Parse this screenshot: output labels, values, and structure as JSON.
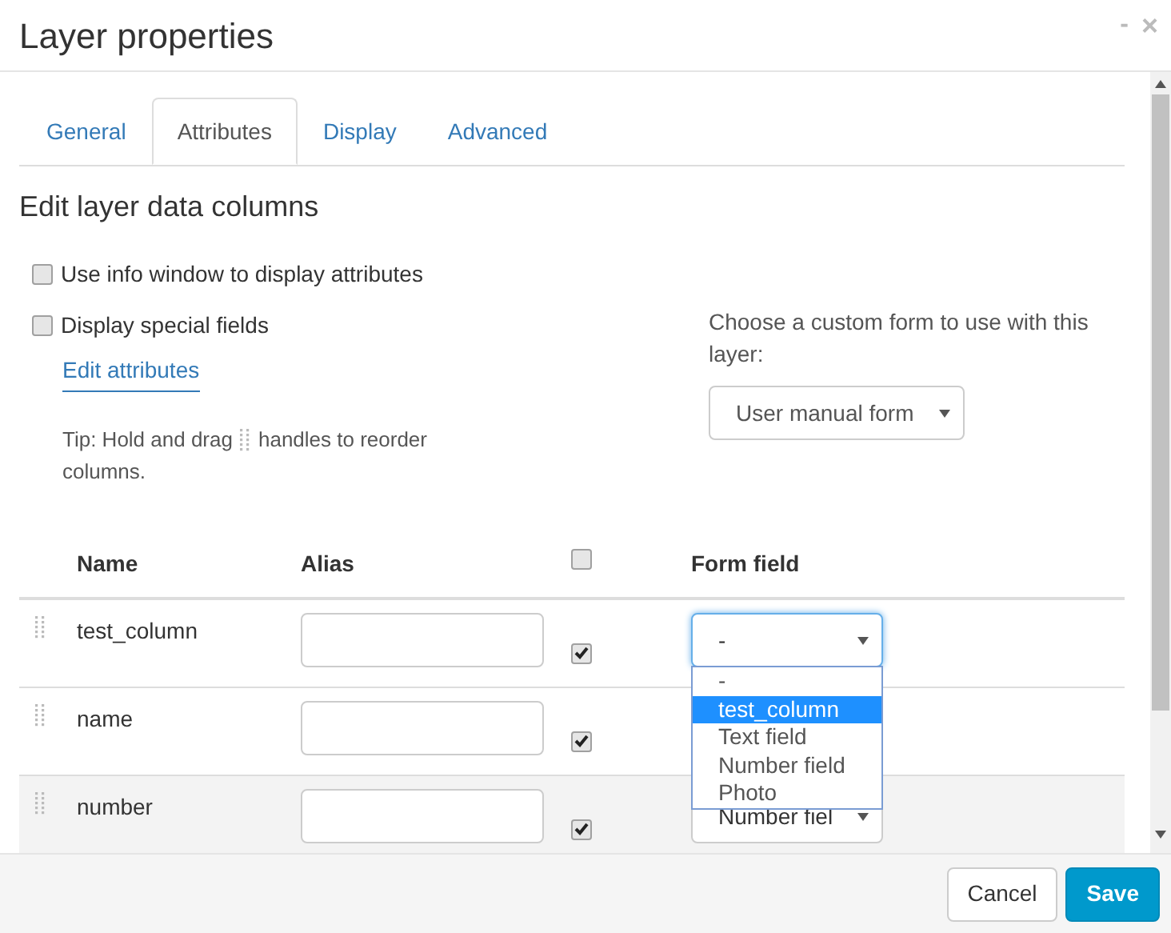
{
  "window": {
    "title": "Layer properties",
    "minimize": "-",
    "close": "×"
  },
  "tabs": [
    {
      "label": "General",
      "selected": false
    },
    {
      "label": "Attributes",
      "selected": true
    },
    {
      "label": "Display",
      "selected": false
    },
    {
      "label": "Advanced",
      "selected": false
    }
  ],
  "heading": "Edit layer data columns",
  "options": [
    {
      "label": "Use info window to display attributes",
      "checked": false
    },
    {
      "label": "Display special fields",
      "checked": false
    }
  ],
  "edit_link": "Edit attributes",
  "tip": {
    "before": "Tip: Hold and drag",
    "after": "handles to reorder",
    "wrap": "columns."
  },
  "custom_form": {
    "label": "Choose a custom form to use with this layer:",
    "value": "User manual form"
  },
  "table": {
    "columns": [
      "Name",
      "Alias",
      "Form field"
    ],
    "all_checked": false,
    "rows": [
      {
        "name": "test_column",
        "checked": true,
        "form_field": "-",
        "hovered": false
      },
      {
        "name": "name",
        "checked": true,
        "hovered": false
      },
      {
        "name": "number",
        "checked": true,
        "form_field": "Number fiel",
        "hovered": true
      }
    ]
  },
  "dropdown": {
    "options": [
      {
        "label": "-",
        "selected": false
      },
      {
        "label": "test_column",
        "selected": true
      },
      {
        "label": "Text field",
        "selected": false
      },
      {
        "label": "Number field",
        "selected": false
      },
      {
        "label": "Photo",
        "selected": false
      }
    ]
  },
  "buttons": [
    {
      "label": "Cancel",
      "kind": "default"
    },
    {
      "label": "Save",
      "kind": "primary"
    }
  ]
}
